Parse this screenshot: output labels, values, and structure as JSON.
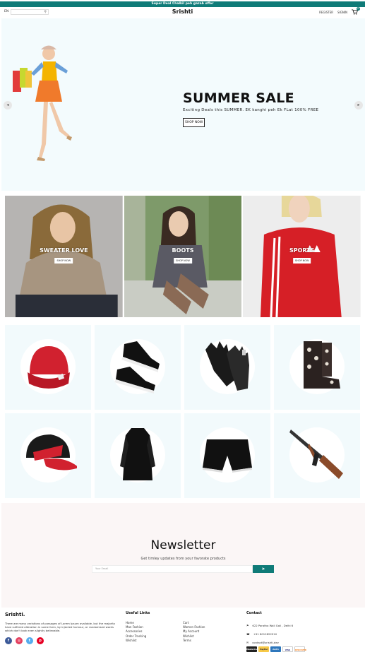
{
  "announcement": "Super Deal Chalkil peh gazab offer",
  "nav": {
    "lang": "EN",
    "search_placeholder": "",
    "logo": "Srishti",
    "register": "REGISTER",
    "signin": "SIGNIN",
    "cart_count": "0"
  },
  "hero": {
    "title": "SUMMER SALE",
    "subtitle": "Exciting Deals this SUMMER. EK kanghi peh Ek FLat 100% FREE",
    "button": "SHOP NOW"
  },
  "categories": [
    {
      "title": "SWEATER LOVE",
      "button": "SHOP NOW"
    },
    {
      "title": "BOOTS",
      "button": "SHOP NOW"
    },
    {
      "title": "SPORTS",
      "button": "SHOP NOW"
    }
  ],
  "products": [
    "beanie-icon",
    "sneakers-icon",
    "gloves-icon",
    "boots-icon",
    "cap-icon",
    "coat-icon",
    "shorts-icon",
    "rifle-icon"
  ],
  "newsletter": {
    "title": "Newsletter",
    "subtitle": "Get timley updates from your favorate products",
    "placeholder": "Your Email",
    "send_icon": "send-icon"
  },
  "footer": {
    "brand": "Srishti.",
    "description": "There are many variations of passages of Lorem Ipsum available, but the majority have suffered alteration in some form, by injected humour, or randomised words which don't look even slightly believable.",
    "links_title": "Useful Links",
    "links": [
      "Home",
      "Cart",
      "Man Fashion",
      "Women Fashion",
      "Accessories",
      "My Account",
      "Order Tracking",
      "Wishlist",
      "Wishlist",
      "Terms"
    ],
    "contact_title": "Contact",
    "contact": {
      "address": "622 Paratha Wali Gali , Delhi 6",
      "phone": "+91 8012822910",
      "email": "contact@srishti.dev"
    },
    "payments": [
      "MasterCard",
      "PayPal",
      "AmEx",
      "VISA",
      "DISCOVER"
    ],
    "colors": {
      "accent": "#0f7b78",
      "facebook": "#3b5998",
      "instagram": "#e4405f",
      "twitter": "#55acee",
      "pinterest": "#e60023"
    }
  }
}
